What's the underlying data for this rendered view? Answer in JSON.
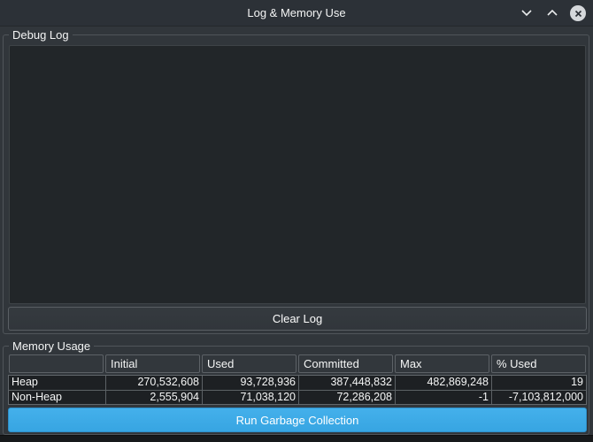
{
  "window": {
    "title": "Log & Memory Use"
  },
  "titlebar": {
    "minimize_icon": "chevron-down",
    "maximize_icon": "chevron-up",
    "close_icon": "circled-x"
  },
  "debug_log": {
    "label": "Debug Log",
    "content": "",
    "clear_button_label": "Clear Log"
  },
  "memory": {
    "label": "Memory Usage",
    "table": {
      "headers": [
        "",
        "Initial",
        "Used",
        "Committed",
        "Max",
        "% Used"
      ],
      "rows": [
        {
          "name": "Heap",
          "values": [
            "270,532,608",
            "93,728,936",
            "387,448,832",
            "482,869,248",
            "19"
          ]
        },
        {
          "name": "Non-Heap",
          "values": [
            "2,555,904",
            "71,038,120",
            "72,286,208",
            "-1",
            "-7,103,812,000"
          ]
        }
      ]
    },
    "gc_button_label": "Run Garbage Collection"
  },
  "colors": {
    "accent": "#3daee9",
    "window_bg": "#31363b",
    "view_bg": "#222629",
    "text": "#fcfcfc"
  }
}
